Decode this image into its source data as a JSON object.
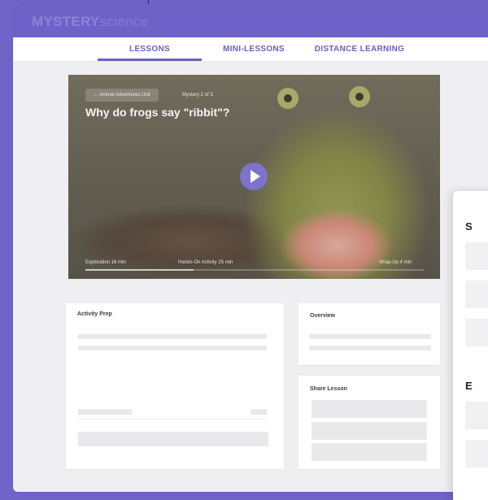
{
  "app": {
    "logo_bold": "MYSTERY",
    "logo_light": "science"
  },
  "nav": {
    "tabs": [
      {
        "label": "LESSONS",
        "active": true
      },
      {
        "label": "MINI-LESSONS",
        "active": false
      },
      {
        "label": "DISTANCE LEARNING",
        "active": false
      }
    ]
  },
  "hero": {
    "unit_label": "← Animal Adventures Unit",
    "mystery_count": "Mystery 2 of 3",
    "title": "Why do frogs say \"ribbit\"?",
    "segments": [
      {
        "label": "Exploration 16 min"
      },
      {
        "label": "Hands-On Activity 25 min"
      },
      {
        "label": "Wrap-Up 4 min"
      }
    ],
    "progress": 0.32
  },
  "cards": {
    "activity_prep": "Activity Prep",
    "overview": "Overview",
    "share_lesson": "Share Lesson"
  },
  "side_panel": {
    "heading_1": "S",
    "heading_2": "E"
  },
  "colors": {
    "brand": "#6e62c9",
    "page_bg": "#efeff1"
  }
}
